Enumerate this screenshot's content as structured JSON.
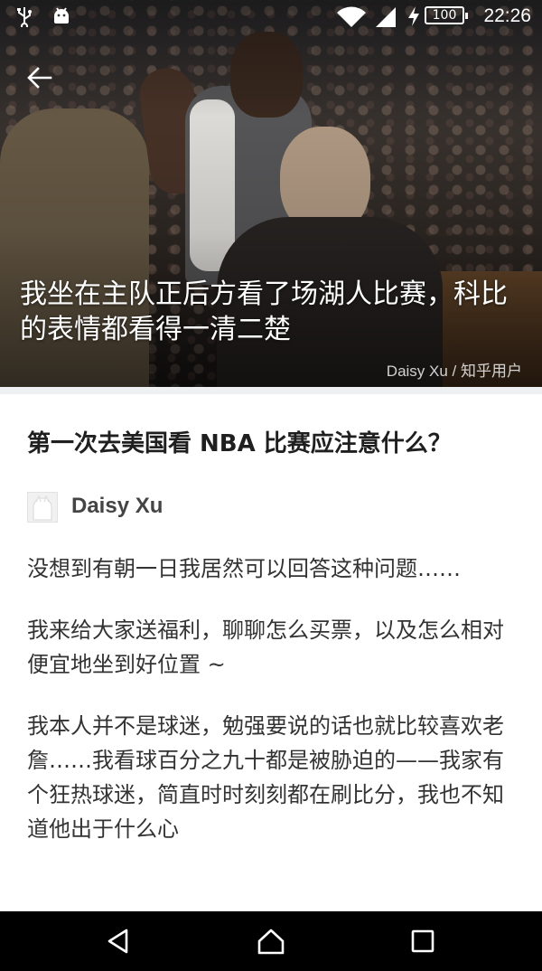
{
  "status_bar": {
    "time": "22:26",
    "battery": "100",
    "icons": [
      "usb-icon",
      "android-debug-icon",
      "wifi-icon",
      "signal-icon",
      "charging-icon",
      "battery-icon"
    ]
  },
  "hero": {
    "title": "我坐在主队正后方看了场湖人比赛，科比的表情都看得一清二楚",
    "credit": "Daisy Xu / 知乎用户"
  },
  "question": {
    "title": "第一次去美国看 NBA 比赛应注意什么？"
  },
  "author": {
    "name": "Daisy Xu"
  },
  "body": {
    "paragraphs": [
      "没想到有朝一日我居然可以回答这种问题……",
      "我来给大家送福利，聊聊怎么买票，以及怎么相对便宜地坐到好位置 ~",
      "我本人并不是球迷，勉强要说的话也就比较喜欢老詹……我看球百分之九十都是被胁迫的——我家有个狂热球迷，简直时时刻刻都在刷比分，我也不知道他出于什么心"
    ]
  },
  "nav": {
    "icons": [
      "back-triangle-icon",
      "home-icon",
      "recents-icon"
    ]
  }
}
